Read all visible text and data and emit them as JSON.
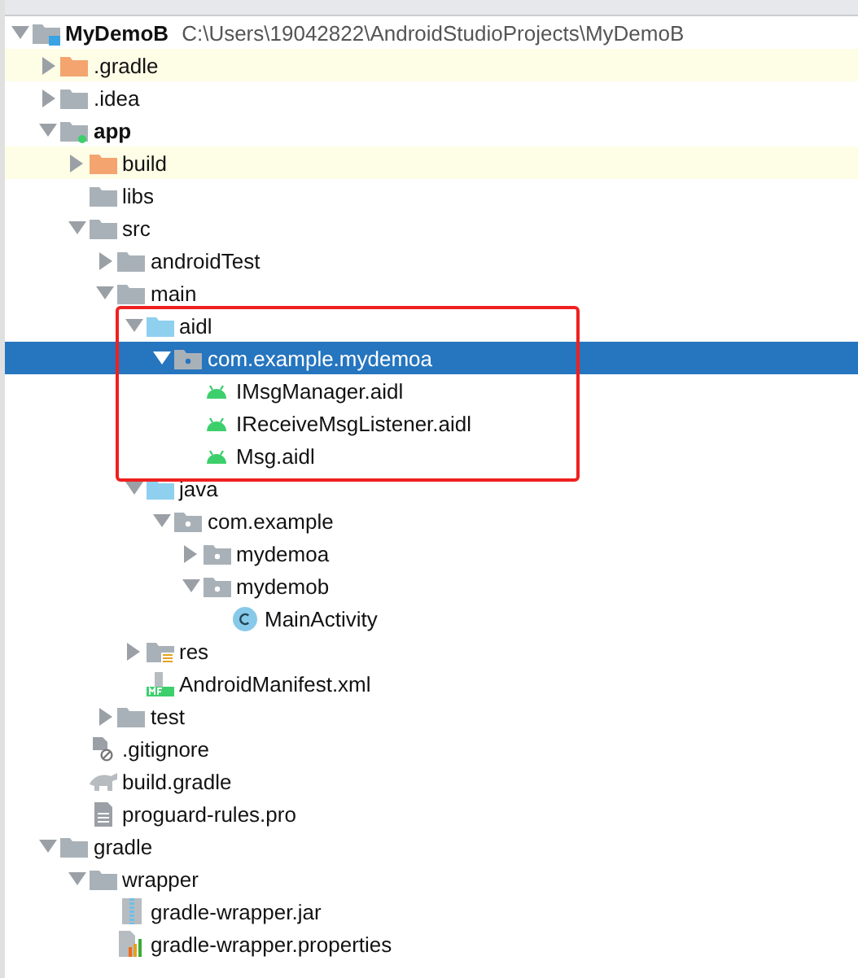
{
  "tree": [
    {
      "name": "MyDemoB",
      "kind": "project",
      "path": "C:\\Users\\19042822\\AndroidStudioProjects\\MyDemoB",
      "expanded": true,
      "selected": false,
      "children": [
        {
          "name": ".gradle",
          "kind": "excluded-folder",
          "expanded": false,
          "selected": false,
          "excluded": true
        },
        {
          "name": ".idea",
          "kind": "folder",
          "expanded": false,
          "selected": false
        },
        {
          "name": "app",
          "kind": "module",
          "expanded": true,
          "selected": false,
          "children": [
            {
              "name": "build",
              "kind": "excluded-folder",
              "expanded": false,
              "selected": false,
              "excluded": true
            },
            {
              "name": "libs",
              "kind": "folder",
              "selected": false
            },
            {
              "name": "src",
              "kind": "folder",
              "expanded": true,
              "selected": false,
              "children": [
                {
                  "name": "androidTest",
                  "kind": "folder",
                  "expanded": false,
                  "selected": false
                },
                {
                  "name": "main",
                  "kind": "folder",
                  "expanded": true,
                  "selected": false,
                  "children": [
                    {
                      "name": "aidl",
                      "kind": "source-folder",
                      "expanded": true,
                      "selected": false,
                      "annotated": true,
                      "children": [
                        {
                          "name": "com.example.mydemoa",
                          "kind": "package",
                          "expanded": true,
                          "selected": true,
                          "children": [
                            {
                              "name": "IMsgManager.aidl",
                              "kind": "aidl",
                              "selected": false
                            },
                            {
                              "name": "IReceiveMsgListener.aidl",
                              "kind": "aidl",
                              "selected": false
                            },
                            {
                              "name": "Msg.aidl",
                              "kind": "aidl",
                              "selected": false
                            }
                          ]
                        }
                      ]
                    },
                    {
                      "name": "java",
                      "kind": "source-folder",
                      "expanded": true,
                      "selected": false,
                      "children": [
                        {
                          "name": "com.example",
                          "kind": "package",
                          "expanded": true,
                          "selected": false,
                          "children": [
                            {
                              "name": "mydemoa",
                              "kind": "package",
                              "expanded": false,
                              "selected": false
                            },
                            {
                              "name": "mydemob",
                              "kind": "package",
                              "expanded": true,
                              "selected": false,
                              "children": [
                                {
                                  "name": "MainActivity",
                                  "kind": "class",
                                  "selected": false
                                }
                              ]
                            }
                          ]
                        }
                      ]
                    },
                    {
                      "name": "res",
                      "kind": "resources",
                      "expanded": false,
                      "selected": false
                    },
                    {
                      "name": "AndroidManifest.xml",
                      "kind": "manifest",
                      "selected": false
                    }
                  ]
                },
                {
                  "name": "test",
                  "kind": "folder",
                  "expanded": false,
                  "selected": false
                }
              ]
            },
            {
              "name": ".gitignore",
              "kind": "ignore-file",
              "selected": false
            },
            {
              "name": "build.gradle",
              "kind": "gradle",
              "selected": false
            },
            {
              "name": "proguard-rules.pro",
              "kind": "text-file",
              "selected": false
            }
          ]
        },
        {
          "name": "gradle",
          "kind": "folder",
          "expanded": true,
          "selected": false,
          "children": [
            {
              "name": "wrapper",
              "kind": "folder",
              "expanded": true,
              "selected": false,
              "children": [
                {
                  "name": "gradle-wrapper.jar",
                  "kind": "jar",
                  "selected": false
                },
                {
                  "name": "gradle-wrapper.properties",
                  "kind": "properties",
                  "selected": false
                }
              ]
            }
          ]
        }
      ]
    }
  ]
}
